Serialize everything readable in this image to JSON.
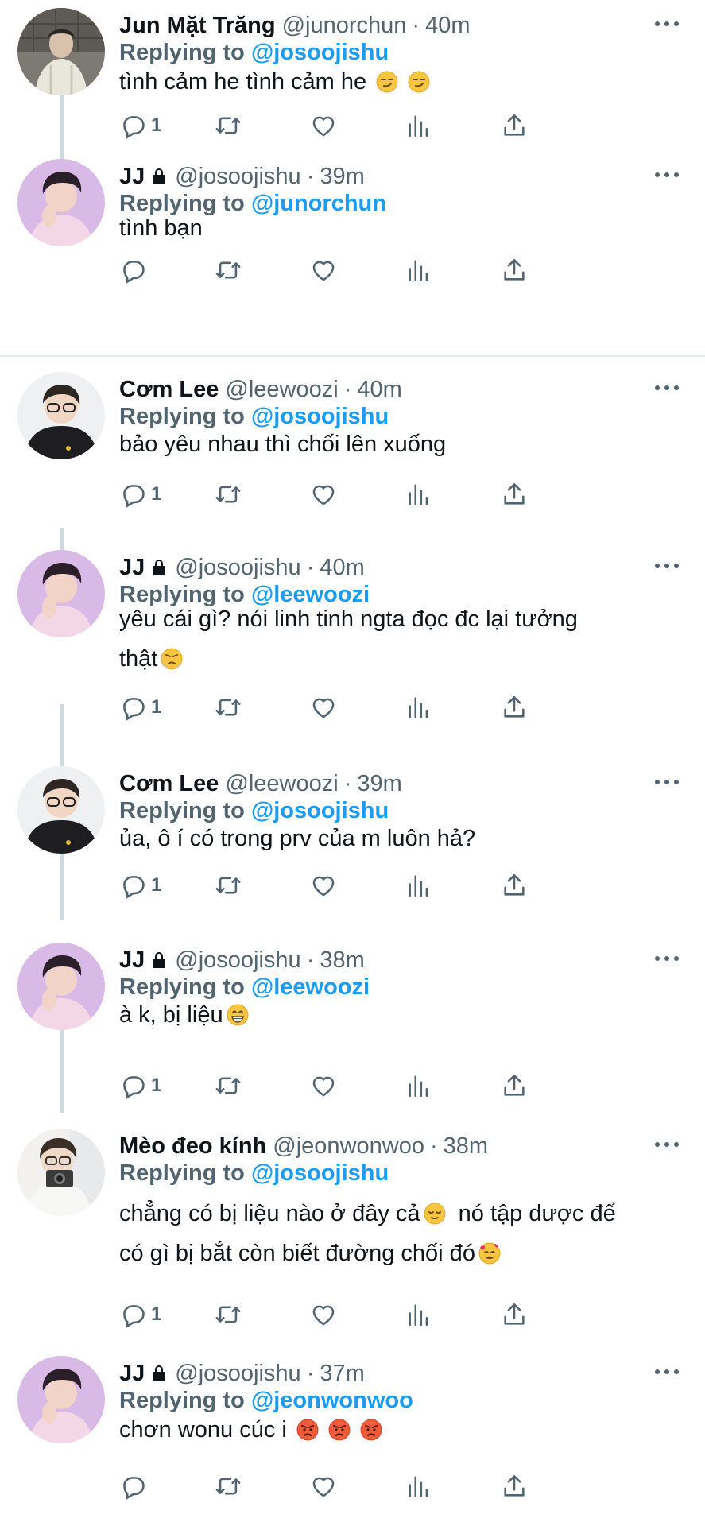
{
  "colors": {
    "link": "#1d9bf0",
    "muted": "#536471",
    "text": "#0f1419"
  },
  "replying_prefix": "Replying to",
  "tweets": [
    {
      "name": "Jun Mặt Trăng",
      "locked": false,
      "handle": "@junorchun",
      "time": "40m",
      "replying_to": "@josoojishu",
      "text": "tình cảm he tình cảm he",
      "emojis": [
        "smirk-emoji",
        "smirk-emoji"
      ],
      "reply_count": "1",
      "avatar": "junorchun-avatar"
    },
    {
      "name": "JJ",
      "locked": true,
      "handle": "@josoojishu",
      "time": "39m",
      "replying_to": "@junorchun",
      "text": "tình bạn",
      "emojis": [],
      "reply_count": "",
      "avatar": "josoojishu-avatar"
    },
    {
      "name": "Cơm Lee",
      "locked": false,
      "handle": "@leewoozi",
      "time": "40m",
      "replying_to": "@josoojishu",
      "text": "bảo yêu nhau thì chối lên xuống",
      "emojis": [],
      "reply_count": "1",
      "avatar": "leewoozi-avatar"
    },
    {
      "name": "JJ",
      "locked": true,
      "handle": "@josoojishu",
      "time": "40m",
      "replying_to": "@leewoozi",
      "text_lines": [
        "yêu cái gì? nói linh tinh ngta đọc đc lại tưởng",
        "thật"
      ],
      "emojis": [
        "huffing-emoji"
      ],
      "reply_count": "1",
      "avatar": "josoojishu-avatar"
    },
    {
      "name": "Cơm Lee",
      "locked": false,
      "handle": "@leewoozi",
      "time": "39m",
      "replying_to": "@josoojishu",
      "text": "ủa, ô í có trong prv của m luôn hả?",
      "emojis": [],
      "reply_count": "1",
      "avatar": "leewoozi-avatar"
    },
    {
      "name": "JJ",
      "locked": true,
      "handle": "@josoojishu",
      "time": "38m",
      "replying_to": "@leewoozi",
      "text": "à k, bị liệu",
      "emojis": [
        "grin-emoji"
      ],
      "reply_count": "1",
      "avatar": "josoojishu-avatar"
    },
    {
      "name": "Mèo đeo kính",
      "locked": false,
      "handle": "@jeonwonwoo",
      "time": "38m",
      "replying_to": "@josoojishu",
      "text_lines": [
        "chẳng có bị liệu nào ở đây cả",
        "có gì bị bắt còn biết đường chối đó"
      ],
      "line1_tail": "nó tập dược để",
      "emojis": [
        "relieved-emoji",
        "smiling-hearts-emoji"
      ],
      "reply_count": "1",
      "avatar": "jeonwonwoo-avatar"
    },
    {
      "name": "JJ",
      "locked": true,
      "handle": "@josoojishu",
      "time": "37m",
      "replying_to": "@jeonwonwoo",
      "text": "chơn wonu cúc i",
      "emojis": [
        "angry-emoji",
        "angry-emoji",
        "angry-emoji"
      ],
      "reply_count": "",
      "avatar": "josoojishu-avatar"
    }
  ]
}
